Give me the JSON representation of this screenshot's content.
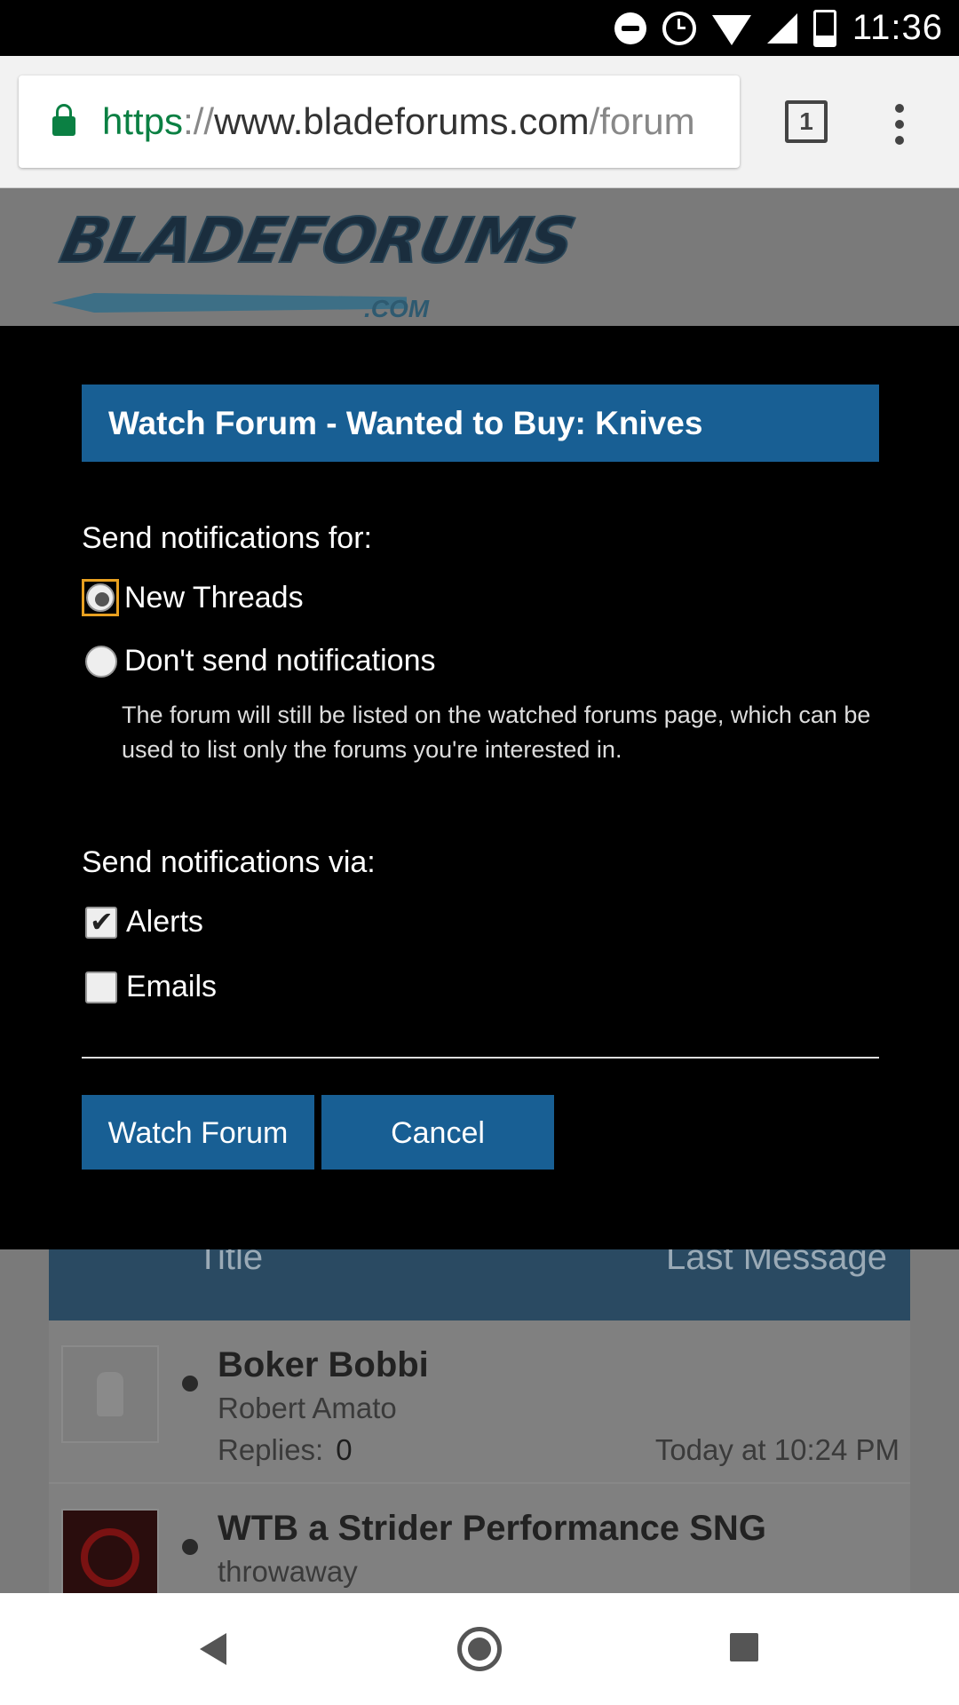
{
  "status_bar": {
    "time": "11:36",
    "icons": [
      "do-not-disturb-icon",
      "alarm-icon",
      "wifi-icon",
      "signal-icon",
      "battery-icon"
    ]
  },
  "browser": {
    "url_scheme": "https",
    "url_sep": "://",
    "url_host": "www.bladeforums.com",
    "url_path": "/forum",
    "tab_count": "1"
  },
  "page": {
    "logo_text": "BLADEFORUMS",
    "logo_suffix": ".COM",
    "table_header": {
      "title": "Title",
      "last_message": "Last Message"
    },
    "threads": [
      {
        "title": "Boker Bobbi",
        "author": "Robert Amato",
        "replies_label": "Replies:",
        "replies": "0",
        "date": "Today at 10:24 PM"
      },
      {
        "title": "WTB a Strider Performance SNG",
        "author": "throwaway"
      }
    ]
  },
  "modal": {
    "title": "Watch Forum - Wanted to Buy: Knives",
    "notify_for_label": "Send notifications for:",
    "options_for": [
      {
        "label": "New Threads",
        "checked": true
      },
      {
        "label": "Don't send notifications",
        "checked": false
      }
    ],
    "dont_send_hint": "The forum will still be listed on the watched forums page, which can be used to list only the forums you're interested in.",
    "notify_via_label": "Send notifications via:",
    "options_via": [
      {
        "label": "Alerts",
        "checked": true
      },
      {
        "label": "Emails",
        "checked": false
      }
    ],
    "watch_button": "Watch Forum",
    "cancel_button": "Cancel"
  },
  "colors": {
    "accent": "#185f94",
    "overlay": "#000000",
    "secure_green": "#0b8043",
    "focus_outline": "#e8a020"
  }
}
